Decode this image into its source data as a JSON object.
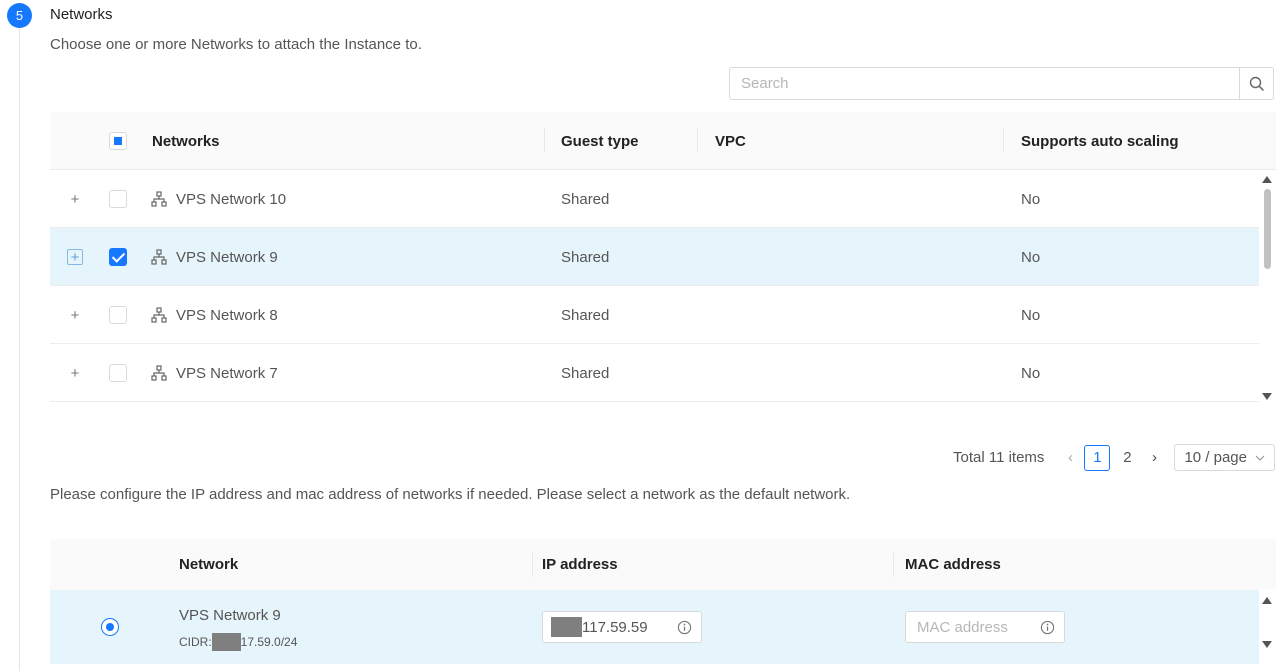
{
  "step": {
    "number": "5",
    "title": "Networks",
    "description": "Choose one or more Networks to attach the Instance to."
  },
  "search": {
    "placeholder": "Search",
    "value": ""
  },
  "networks_table": {
    "columns": [
      "Networks",
      "Guest type",
      "VPC",
      "Supports auto scaling"
    ],
    "header_checkbox_state": "indeterminate",
    "rows": [
      {
        "name": "VPS Network 10",
        "guest_type": "Shared",
        "vpc": "",
        "auto_scaling": "No",
        "checked": false
      },
      {
        "name": "VPS Network 9",
        "guest_type": "Shared",
        "vpc": "",
        "auto_scaling": "No",
        "checked": true
      },
      {
        "name": "VPS Network 8",
        "guest_type": "Shared",
        "vpc": "",
        "auto_scaling": "No",
        "checked": false
      },
      {
        "name": "VPS Network 7",
        "guest_type": "Shared",
        "vpc": "",
        "auto_scaling": "No",
        "checked": false
      }
    ]
  },
  "pagination": {
    "total": "Total 11 items",
    "pages": [
      "1",
      "2"
    ],
    "current_page": "1",
    "page_size": "10 / page"
  },
  "config": {
    "instructions": "Please configure the IP address and mac address of networks if needed. Please select a network as the default network.",
    "columns": [
      "Network",
      "IP address",
      "MAC address"
    ],
    "rows": [
      {
        "network": "VPS Network 9",
        "cidr_prefix": "CIDR:",
        "cidr_suffix": "17.59.0/24",
        "ip_value": "117.59.59",
        "mac_placeholder": "MAC address",
        "is_default": true
      }
    ]
  },
  "colors": {
    "accent": "#1677ff",
    "selected_row": "#e6f4fb",
    "header_bg": "#fafafa"
  },
  "icons": [
    "search-icon",
    "network-icon",
    "info-icon",
    "plus-icon",
    "chevron-left-icon",
    "chevron-right-icon",
    "chevron-down-icon"
  ]
}
